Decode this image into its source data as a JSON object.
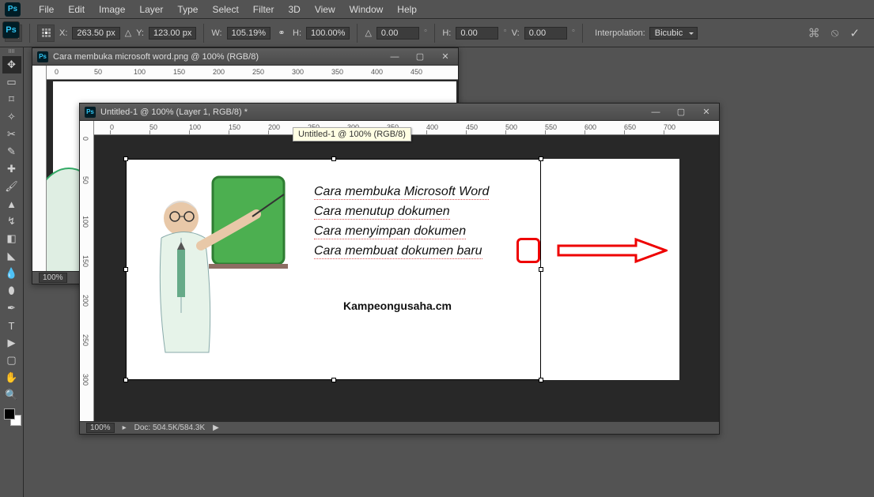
{
  "menu": {
    "items": [
      "File",
      "Edit",
      "Image",
      "Layer",
      "Type",
      "Select",
      "Filter",
      "3D",
      "View",
      "Window",
      "Help"
    ]
  },
  "opt": {
    "x_label": "X:",
    "x": "263.50 px",
    "y_label": "Y:",
    "y": "123.00 px",
    "w_label": "W:",
    "w": "105.19%",
    "h_label": "H:",
    "h": "100.00%",
    "angle_label": "△",
    "angle": "0.00",
    "h2_label": "H:",
    "h2": "0.00",
    "v_label": "V:",
    "v": "0.00",
    "interp_label": "Interpolation:",
    "interp": "Bicubic"
  },
  "win1": {
    "title": "Cara membuka microsoft word.png @ 100% (RGB/8)",
    "zoom": "100%"
  },
  "win2": {
    "title": "Untitled-1 @ 100% (Layer 1, RGB/8) *",
    "zoom": "100%",
    "doc": "Doc: 504.5K/584.3K"
  },
  "tooltip": "Untitled-1 @ 100% (RGB/8)",
  "content": {
    "items": [
      "Cara membuka Microsoft Word",
      "Cara menutup dokumen",
      "Cara menyimpan dokumen",
      "Cara membuat dokumen baru"
    ],
    "brand": "Kampeongusaha.cm"
  },
  "ruler_h": [
    "0",
    "50",
    "100",
    "150",
    "200",
    "250",
    "300",
    "350",
    "400",
    "450",
    "500",
    "550",
    "600",
    "650",
    "700"
  ],
  "ruler_v": [
    "0",
    "50",
    "100",
    "150",
    "200",
    "250",
    "300"
  ]
}
